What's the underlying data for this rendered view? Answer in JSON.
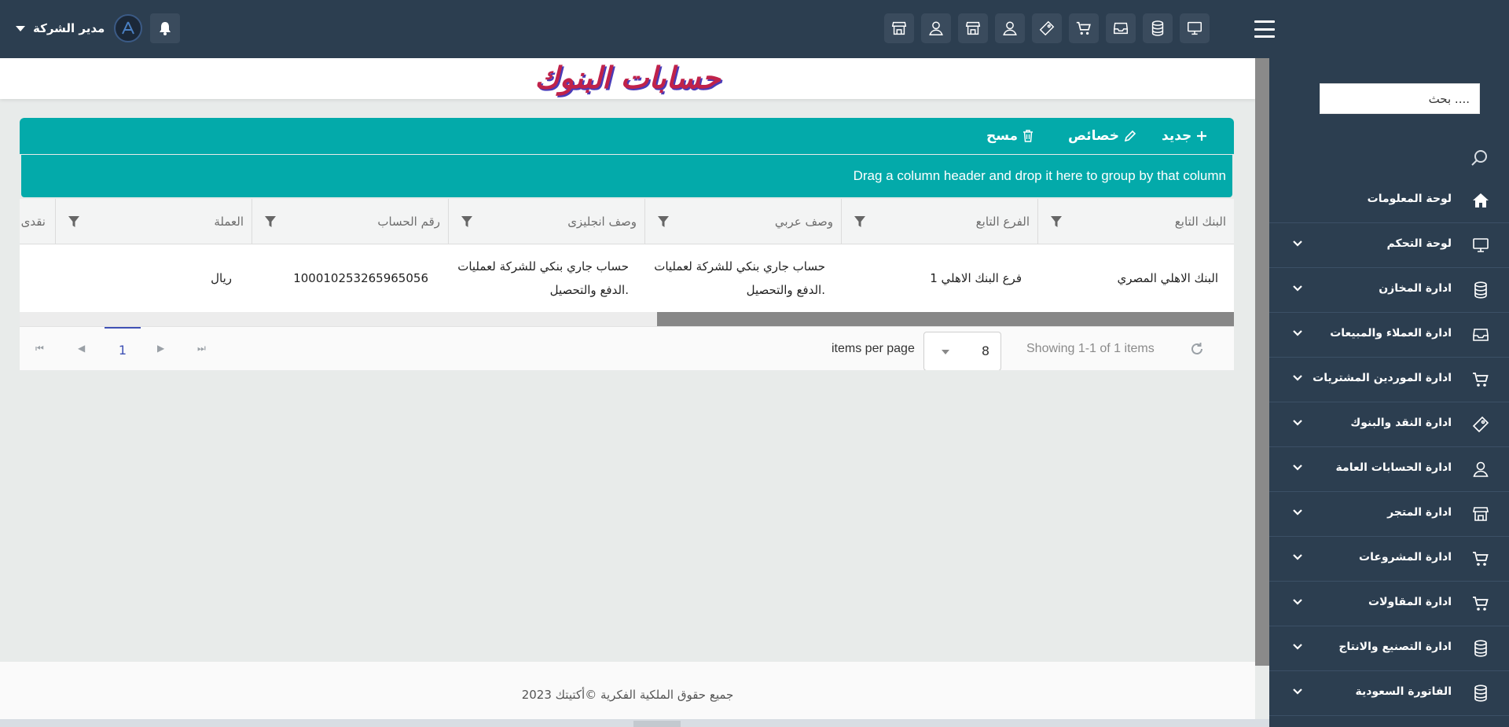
{
  "header": {
    "user_name": "مدير الشركة",
    "quick_icons": [
      "monitor-icon",
      "database-icon",
      "inbox-icon",
      "cart-icon",
      "ticket-icon",
      "user-icon",
      "store-icon",
      "user-icon",
      "store-icon"
    ]
  },
  "page": {
    "title": "حسابات البنوك"
  },
  "toolbar": {
    "new_label": "جديد",
    "properties_label": "خصائص",
    "delete_label": "مسح"
  },
  "grid": {
    "group_hint": "Drag a column header and drop it here to group by that column",
    "columns": [
      "البنك التابع",
      "الفرع التابع",
      "وصف عربي",
      "وصف انجليزى",
      "رقم الحساب",
      "العملة",
      "نقدى"
    ],
    "rows": [
      {
        "bank": "البنك الاهلي المصري",
        "branch": "فرع البنك الاهلي 1",
        "desc_ar": "حساب جاري بنكي للشركة لعمليات الدفع والتحصيل.",
        "desc_en": "حساب جاري بنكي للشركة لعمليات الدفع والتحصيل.",
        "account_no": "100010253265965056",
        "currency": "ريال",
        "cash": ""
      }
    ]
  },
  "pager": {
    "current_page": "1",
    "items_per_page_label": "items per page",
    "items_per_page": "8",
    "showing": "Showing 1-1 of 1 items"
  },
  "footer": {
    "text": "جميع حقوق الملكية الفكرية ©أكتيتك 2023"
  },
  "sidebar": {
    "search_placeholder": "بحث ....",
    "items": [
      {
        "label": "لوحة المعلومات",
        "icon": "home-icon",
        "has_children": false
      },
      {
        "label": "لوحة التحكم",
        "icon": "monitor-icon",
        "has_children": true
      },
      {
        "label": "ادارة المخازن",
        "icon": "database-icon",
        "has_children": true
      },
      {
        "label": "ادارة العملاء والمبيعات",
        "icon": "inbox-icon",
        "has_children": true
      },
      {
        "label": "ادارة الموردين المشتريات",
        "icon": "cart-icon",
        "has_children": true
      },
      {
        "label": "ادارة النقد والبنوك",
        "icon": "ticket-icon",
        "has_children": true
      },
      {
        "label": "ادارة الحسابات العامة",
        "icon": "user-icon",
        "has_children": true
      },
      {
        "label": "ادارة المتجر",
        "icon": "store-icon",
        "has_children": true
      },
      {
        "label": "ادارة المشروعات",
        "icon": "cart-icon",
        "has_children": true
      },
      {
        "label": "ادارة المقاولات",
        "icon": "cart-icon",
        "has_children": true
      },
      {
        "label": "ادارة التصنيع والانتاج",
        "icon": "database-icon",
        "has_children": true
      },
      {
        "label": "الفاتورة السعودية",
        "icon": "database-icon",
        "has_children": true
      }
    ]
  }
}
